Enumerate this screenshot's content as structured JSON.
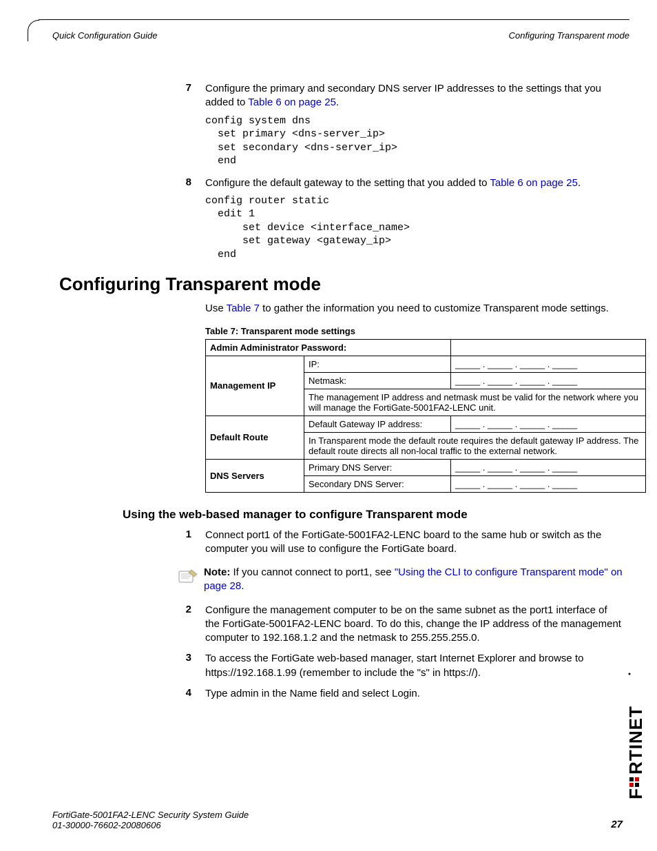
{
  "header": {
    "left": "Quick Configuration Guide",
    "right": "Configuring Transparent mode"
  },
  "steps_a": [
    {
      "num": "7",
      "text_pre": "Configure the primary and secondary DNS server IP addresses to the settings that you added to ",
      "link": "Table 6 on page 25",
      "text_post": "."
    }
  ],
  "code_a": "config system dns\n  set primary <dns-server_ip>\n  set secondary <dns-server_ip>\n  end",
  "steps_b": [
    {
      "num": "8",
      "text_pre": "Configure the default gateway to the setting that you added to ",
      "link": "Table 6 on page 25",
      "text_post": "."
    }
  ],
  "code_b": "config router static\n  edit 1\n      set device <interface_name>\n      set gateway <gateway_ip>\n  end",
  "section_title": "Configuring Transparent mode",
  "section_intro_pre": "Use ",
  "section_intro_link": "Table 7",
  "section_intro_post": " to gather the information you need to customize Transparent mode settings.",
  "table_caption": "Table 7: Transparent mode settings",
  "table": {
    "r1c1": "Admin Administrator Password:",
    "r2head": "Management IP",
    "r2a": "IP:",
    "r2b": "Netmask:",
    "r2note": "The management IP address and netmask must be valid for the network where you will manage the FortiGate-5001FA2-LENC unit.",
    "r3head": "Default Route",
    "r3a": "Default Gateway IP address:",
    "r3note": "In Transparent mode the default route requires the default gateway IP address. The default route directs all non-local traffic to the external network.",
    "r4head": "DNS Servers",
    "r4a": "Primary DNS Server:",
    "r4b": "Secondary DNS Server:",
    "blank": "_____ . _____ . _____ . _____"
  },
  "subsection_title": "Using the web-based manager to configure Transparent mode",
  "steps_c": [
    {
      "num": "1",
      "text": "Connect port1 of the FortiGate-5001FA2-LENC board to the same hub or switch as the computer you will use to configure the FortiGate board."
    }
  ],
  "note": {
    "label": "Note:",
    "pre": " If you cannot connect to port1, see ",
    "link": "\"Using the CLI to configure Transparent mode\" on page 28",
    "post": "."
  },
  "steps_d": [
    {
      "num": "2",
      "text": "Configure the management computer to be on the same subnet as the port1 interface of the FortiGate-5001FA2-LENC board. To do this, change the IP address of the management computer to 192.168.1.2 and the netmask to 255.255.255.0."
    },
    {
      "num": "3",
      "text": "To access the FortiGate web-based manager, start Internet Explorer and browse to https://192.168.1.99 (remember to include the \"s\" in https://)."
    },
    {
      "num": "4",
      "text": "Type admin in the Name field and select Login."
    }
  ],
  "footer": {
    "line1": "FortiGate-5001FA2-LENC   Security System Guide",
    "line2": "01-30000-76602-20080606",
    "page": "27"
  }
}
